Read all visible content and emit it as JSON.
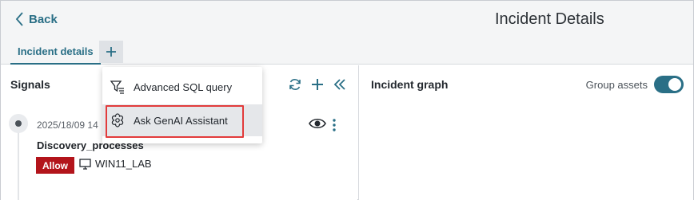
{
  "header": {
    "back_label": "Back",
    "title": "Incident Details"
  },
  "tabs": {
    "active_label": "Incident details"
  },
  "signals": {
    "title": "Signals",
    "item": {
      "date": "2025/18/09 14",
      "name": "Discovery_processes",
      "badge": "Allow",
      "host": "WIN11_LAB"
    }
  },
  "graph": {
    "title": "Incident graph",
    "group_assets_label": "Group assets",
    "group_assets_on": true
  },
  "menu": {
    "items": [
      {
        "label": "Advanced SQL query"
      },
      {
        "label": "Ask GenAI Assistant"
      }
    ]
  },
  "colors": {
    "accent": "#2a6f86",
    "badge_red": "#b3141b",
    "highlight": "#e23b3b"
  },
  "icons": [
    "chevron-left-icon",
    "plus-icon",
    "refresh-icon",
    "collapse-left-icon",
    "eye-icon",
    "more-vertical-icon",
    "monitor-icon",
    "filter-list-icon",
    "genai-icon"
  ]
}
